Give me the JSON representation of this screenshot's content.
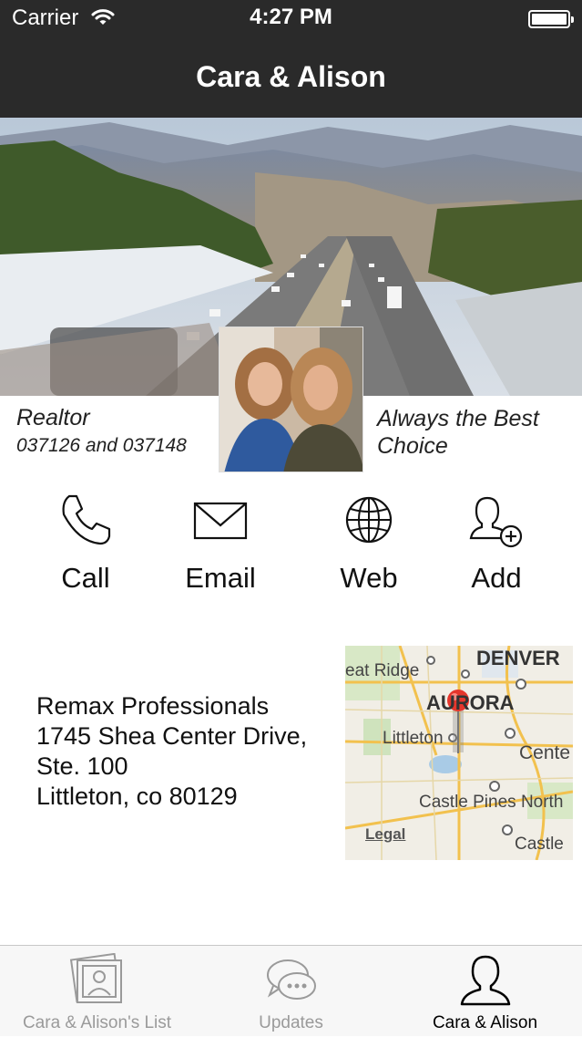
{
  "status_bar": {
    "carrier": "Carrier",
    "time": "4:27 PM"
  },
  "nav": {
    "title": "Cara & Alison"
  },
  "profile": {
    "role": "Realtor",
    "license": "037126 and 037148",
    "tagline": "Always the Best Choice"
  },
  "actions": [
    {
      "label": "Call",
      "icon": "phone-icon"
    },
    {
      "label": "Email",
      "icon": "envelope-icon"
    },
    {
      "label": "Web",
      "icon": "globe-icon"
    },
    {
      "label": "Add",
      "icon": "add-contact-icon"
    }
  ],
  "address": {
    "line1": "Remax Professionals",
    "line2": "1745 Shea Center Drive,",
    "line3": "Ste. 100",
    "line4": "Littleton, co 80129"
  },
  "map": {
    "labels": {
      "denver": "DENVER",
      "wheat_ridge": "eat Ridge",
      "aurora": "AURORA",
      "littleton": "Littleton",
      "centennial": "Cente",
      "castle_pines": "Castle Pines North",
      "castle": "Castle",
      "legal": "Legal"
    }
  },
  "tabbar": {
    "tabs": [
      {
        "label": "Cara & Alison's List",
        "icon": "list-photo-icon",
        "active": false
      },
      {
        "label": "Updates",
        "icon": "chat-bubble-icon",
        "active": false
      },
      {
        "label": "Cara & Alison",
        "icon": "person-icon",
        "active": true
      }
    ]
  },
  "colors": {
    "nav_bg": "#2a2a2a",
    "tab_active": "#000000",
    "tab_inactive": "#9a9a9a",
    "map_pin": "#e5362c",
    "map_road": "#f2c14e"
  }
}
